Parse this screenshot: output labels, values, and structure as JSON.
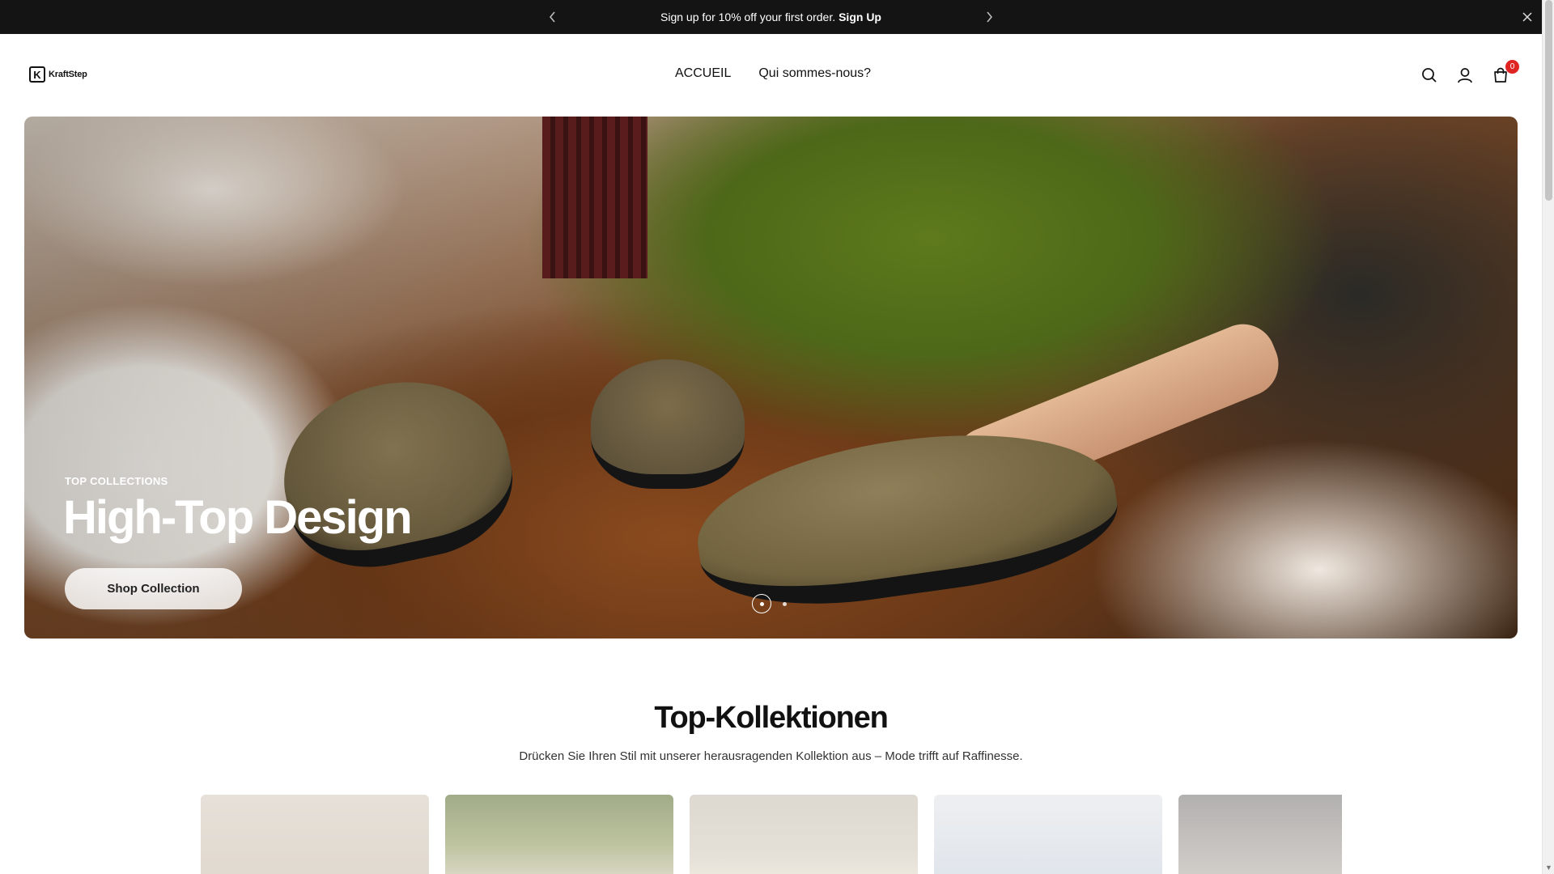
{
  "announcement": {
    "text": "Sign up for 10% off your first order.",
    "link": "Sign Up"
  },
  "header": {
    "logo_mark": "K",
    "logo_word": "KraftStep",
    "nav": [
      {
        "label": "ACCUEIL"
      },
      {
        "label": "Qui sommes-nous?"
      }
    ],
    "cart_count": "0"
  },
  "hero": {
    "eyebrow": "TOP COLLECTIONS",
    "title": "High-Top Design",
    "cta_label": "Shop Collection",
    "slides_total": 2,
    "active_slide": 1
  },
  "collections": {
    "title": "Top-Kollektionen",
    "subtitle": "Drücken Sie Ihren Stil mit unserer herausragenden Kollektion aus – Mode trifft auf Raffinesse."
  },
  "icons": {
    "prev": "chevron-left-icon",
    "next": "chevron-right-icon",
    "close": "close-icon",
    "search": "search-icon",
    "account": "user-icon",
    "cart": "cart-icon"
  }
}
